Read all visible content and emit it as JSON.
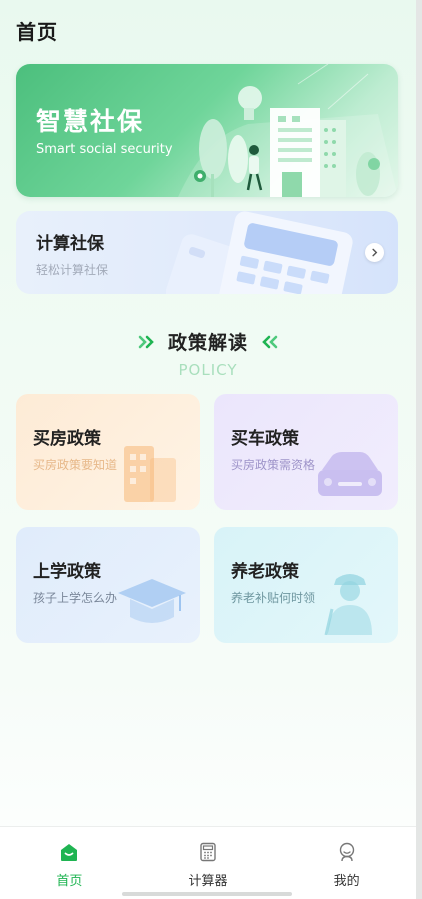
{
  "page": {
    "title": "首页"
  },
  "banner": {
    "title": "智慧社保",
    "subtitle": "Smart social security"
  },
  "calculator_card": {
    "title": "计算社保",
    "subtitle": "轻松计算社保",
    "arrow_icon": "chevron-right-icon"
  },
  "policy_section": {
    "title": "政策解读",
    "subtitle": "POLICY",
    "items": [
      {
        "title": "买房政策",
        "subtitle": "买房政策要知道",
        "icon": "building-icon",
        "color": "#f5b878"
      },
      {
        "title": "买车政策",
        "subtitle": "买房政策需资格",
        "icon": "car-icon",
        "color": "#a99ae6"
      },
      {
        "title": "上学政策",
        "subtitle": "孩子上学怎么办",
        "icon": "graduation-cap-icon",
        "color": "#9ec4f0"
      },
      {
        "title": "养老政策",
        "subtitle": "养老补贴何时领",
        "icon": "elderly-person-icon",
        "color": "#8fd3df"
      }
    ]
  },
  "tabbar": {
    "tabs": [
      {
        "label": "首页",
        "icon": "home-icon",
        "active": true
      },
      {
        "label": "计算器",
        "icon": "calculator-icon",
        "active": false
      },
      {
        "label": "我的",
        "icon": "profile-icon",
        "active": false
      }
    ]
  },
  "colors": {
    "accent": "#1fb452",
    "banner_green": "#4cbf7d",
    "policy_subtitle_green": "#a9dfbd"
  }
}
